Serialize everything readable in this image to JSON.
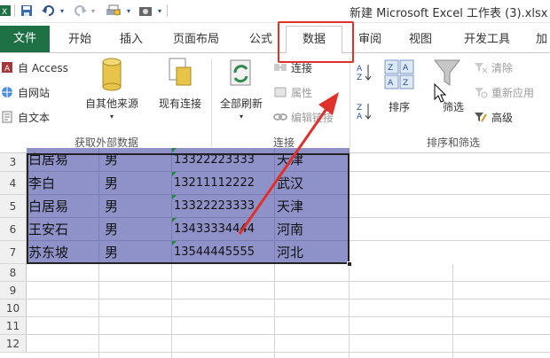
{
  "window": {
    "title": "新建 Microsoft Excel 工作表 (3).xlsx"
  },
  "tabs": {
    "file": "文件",
    "home": "开始",
    "insert": "插入",
    "page_layout": "页面布局",
    "formulas": "公式",
    "data": "数据",
    "review": "审阅",
    "view": "视图",
    "developer": "开发工具",
    "more": "加"
  },
  "ribbon": {
    "get_external": {
      "from_access": "自 Access",
      "from_web": "自网站",
      "from_text": "自文本",
      "from_other": "自其他来源",
      "existing_connections": "现有连接",
      "group_label": "获取外部数据"
    },
    "connections": {
      "refresh_all": "全部刷新",
      "connections": "连接",
      "properties": "属性",
      "edit_links": "编辑链接",
      "group_label": "连接"
    },
    "sort_filter": {
      "sort": "排序",
      "filter": "筛选",
      "clear": "清除",
      "reapply": "重新应用",
      "advanced": "高级",
      "group_label": "排序和筛选"
    }
  },
  "sheet": {
    "rows": [
      {
        "row": "3",
        "name": "白居易",
        "gender": "男",
        "phone": "13322223333",
        "city": "天津"
      },
      {
        "row": "4",
        "name": "李白",
        "gender": "男",
        "phone": "13211112222",
        "city": "武汉"
      },
      {
        "row": "5",
        "name": "白居易",
        "gender": "男",
        "phone": "13322223333",
        "city": "天津"
      },
      {
        "row": "6",
        "name": "王安石",
        "gender": "男",
        "phone": "13433334444",
        "city": "河南"
      },
      {
        "row": "7",
        "name": "苏东坡",
        "gender": "男",
        "phone": "13544445555",
        "city": "河北"
      }
    ],
    "empty_rows": [
      "8",
      "9",
      "10",
      "11",
      "12"
    ]
  },
  "colors": {
    "file_tab": "#1e7145",
    "selection": "#8f92c9",
    "highlight": "#e0302a"
  }
}
